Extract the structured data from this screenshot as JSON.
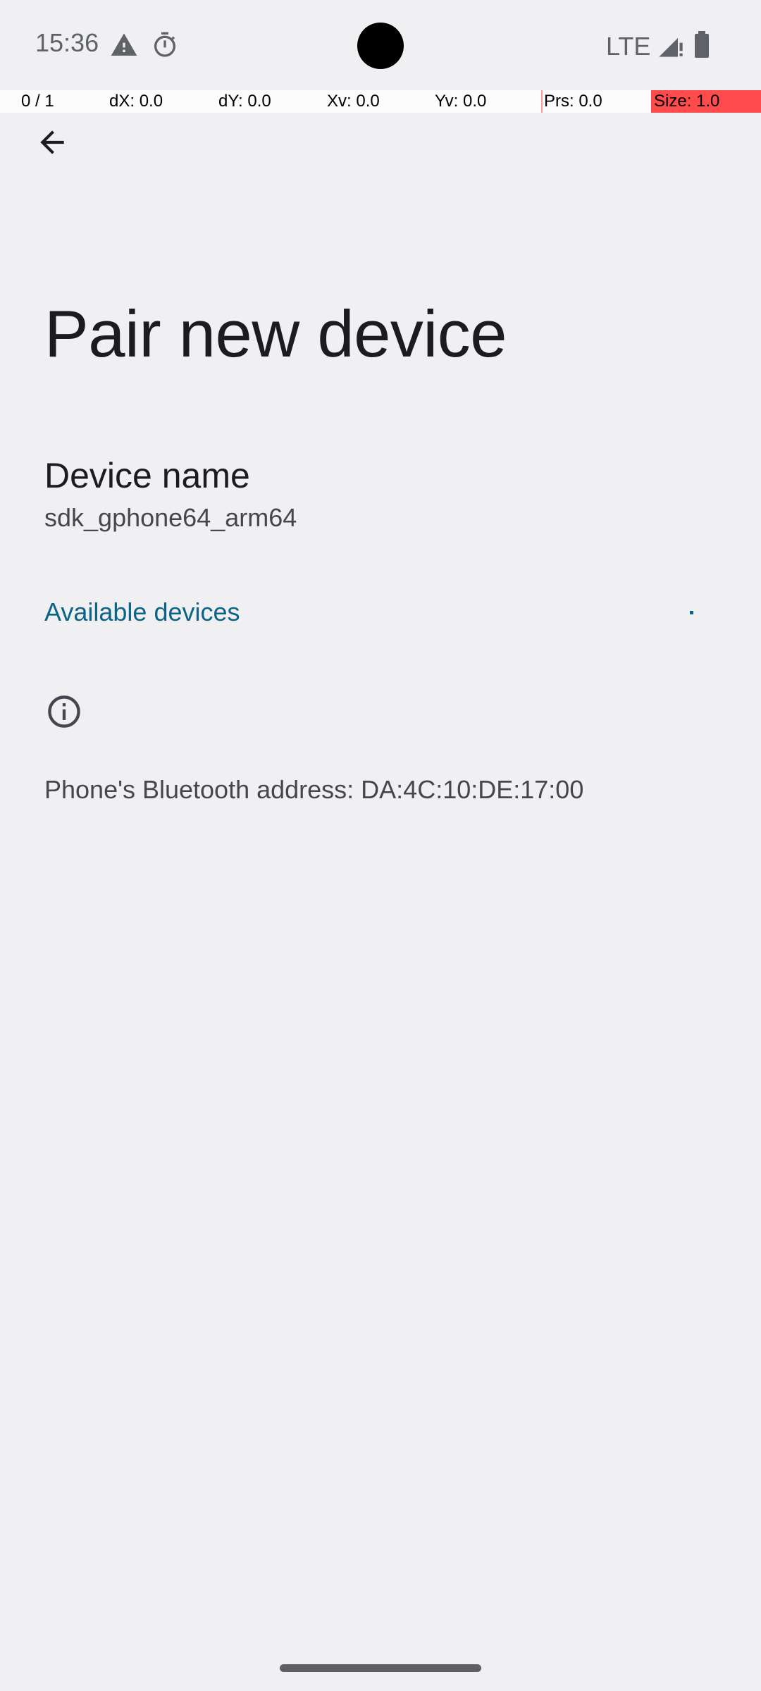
{
  "status_bar": {
    "time": "15:36",
    "icons": [
      "warning-icon",
      "timer-icon",
      "lte-icon",
      "signal-icon",
      "battery-icon"
    ],
    "network_label": "LTE"
  },
  "pointer_overlay": {
    "pointer": "0 / 1",
    "dx": "dX: 0.0",
    "dy": "dY: 0.0",
    "xv": "Xv: 0.0",
    "yv": "Yv: 0.0",
    "prs": "Prs: 0.0",
    "size": "Size: 1.0"
  },
  "toolbar": {
    "back_icon": "arrow-back-icon"
  },
  "page": {
    "title": "Pair new device"
  },
  "device_name": {
    "label": "Device name",
    "value": "sdk_gphone64_arm64"
  },
  "available_devices": {
    "header": "Available devices"
  },
  "footer": {
    "info_icon": "info-icon",
    "bluetooth_address": "Phone's Bluetooth address: DA:4C:10:DE:17:00"
  },
  "colors": {
    "background": "#f0f0f3",
    "accent": "#0b6486",
    "text_primary": "#1c1b1f",
    "text_secondary": "#44474e",
    "overlay_highlight": "#ff4b4b"
  }
}
